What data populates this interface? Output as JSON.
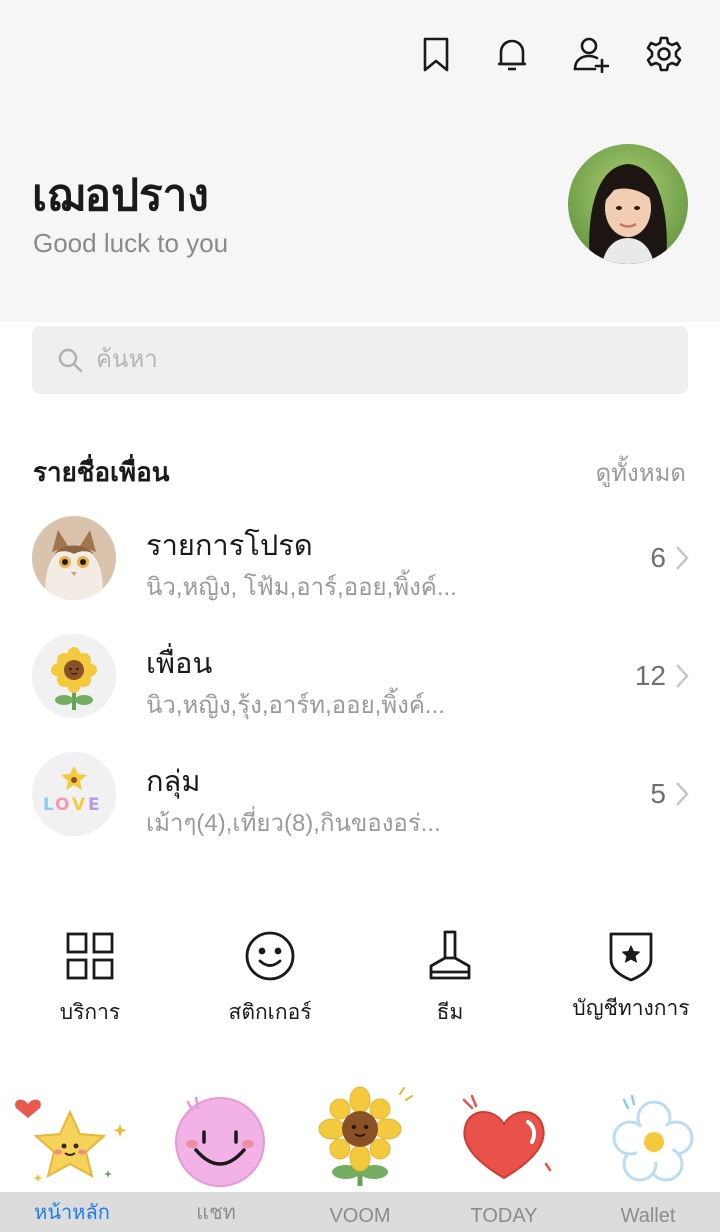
{
  "header": {
    "icons": [
      "bookmark-icon",
      "bell-icon",
      "add-friend-icon",
      "settings-icon"
    ],
    "profile_name": "เฌอปราง",
    "status_message": "Good luck to you"
  },
  "search": {
    "placeholder": "ค้นหา"
  },
  "friends_section": {
    "title": "รายชื่อเพื่อน",
    "see_all": "ดูทั้งหมด",
    "rows": [
      {
        "title": "รายการโปรด",
        "subtitle": "นิว,หญิง, โฟ้ม,อาร์,ออย,พิ้งค์...",
        "count": "6"
      },
      {
        "title": "เพื่อน",
        "subtitle": "นิว,หญิง,รุ้ง,อาร์ท,ออย,พิ้งค์...",
        "count": "12"
      },
      {
        "title": "กลุ่ม",
        "subtitle": "เม้าๆ(4),เที่ยว(8),กินของอร่...",
        "count": "5"
      }
    ]
  },
  "services": [
    {
      "label": "บริการ",
      "icon": "grid-icon"
    },
    {
      "label": "สติกเกอร์",
      "icon": "smiley-icon"
    },
    {
      "label": "ธีม",
      "icon": "paint-brush-icon"
    },
    {
      "label": "บัญชีทางการ",
      "icon": "official-badge-icon"
    }
  ],
  "tabs": [
    {
      "label": "หน้าหลัก",
      "icon": "star-sticker-icon",
      "active": true
    },
    {
      "label": "แชท",
      "icon": "smile-sticker-icon",
      "active": false
    },
    {
      "label": "VOOM",
      "icon": "sunflower-sticker-icon",
      "active": false
    },
    {
      "label": "TODAY",
      "icon": "heart-sticker-icon",
      "active": false
    },
    {
      "label": "Wallet",
      "icon": "flower-sticker-icon",
      "active": false
    }
  ],
  "colors": {
    "accent": "#1d7ee5",
    "header_bg": "#f6f6f6",
    "muted_text": "#9a9a9a"
  }
}
